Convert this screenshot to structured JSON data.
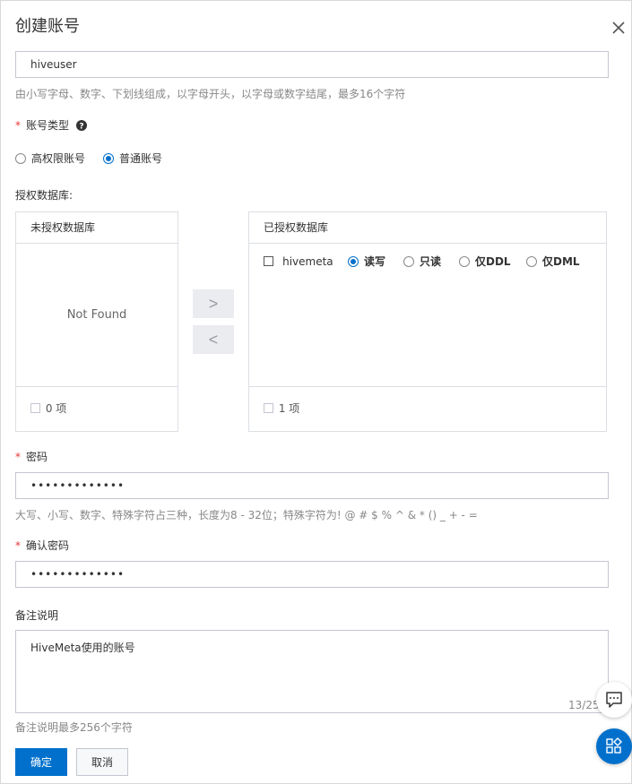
{
  "dialog": {
    "title": "创建账号"
  },
  "account_name": {
    "value": "hiveuser",
    "help": "由小写字母、数字、下划线组成，以字母开头，以字母或数字结尾，最多16个字符"
  },
  "account_type": {
    "required_mark": "*",
    "label": "账号类型",
    "options": [
      {
        "label": "高权限账号",
        "selected": false
      },
      {
        "label": "普通账号",
        "selected": true
      }
    ]
  },
  "authorized_db": {
    "label": "授权数据库:",
    "unauthorized_panel": {
      "title": "未授权数据库",
      "empty_text": "Not Found",
      "count": "0 项"
    },
    "authorized_panel": {
      "title": "已授权数据库",
      "items": [
        {
          "name": "hivemeta",
          "permissions": [
            "读写",
            "只读",
            "仅DDL",
            "仅DML"
          ],
          "selected_permission": "读写"
        }
      ],
      "count": "1 项"
    },
    "move_right": ">",
    "move_left": "<"
  },
  "password": {
    "required_mark": "*",
    "label": "密码",
    "value": "•••••••••••••",
    "help": "大写、小写、数字、特殊字符占三种，长度为8 - 32位；特殊字符为! @ # $ % ^ & * () _ + - ="
  },
  "confirm_password": {
    "required_mark": "*",
    "label": "确认密码",
    "value": "•••••••••••••"
  },
  "remark": {
    "label": "备注说明",
    "value": "HiveMeta使用的账号",
    "counter": "13/256",
    "help": "备注说明最多256个字符"
  },
  "buttons": {
    "confirm": "确定",
    "cancel": "取消"
  },
  "colors": {
    "primary": "#0070cc",
    "required": "#e53935",
    "border": "#dcdee3"
  }
}
